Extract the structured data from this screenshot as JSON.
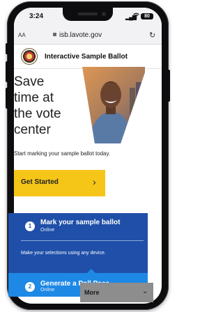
{
  "status_bar": {
    "time": "3:24",
    "battery": "80",
    "icons": [
      "signal-icon",
      "wifi-icon",
      "battery-icon"
    ]
  },
  "browser": {
    "text_size_label": "AA",
    "url": "isb.lavote.gov",
    "icons": [
      "lock-icon",
      "reload-icon"
    ]
  },
  "header": {
    "title": "Interactive Sample Ballot",
    "logo": "county-seal-logo"
  },
  "hero": {
    "lines": [
      "Save",
      "time at",
      "the vote",
      "center"
    ],
    "subtitle": "Start marking your sample ballot today."
  },
  "cta": {
    "label": "Get Started",
    "icon": "chevron-right-icon"
  },
  "steps": [
    {
      "number": "1",
      "title": "Mark your sample ballot",
      "subtitle": "Online",
      "description": "Make your selections using any device."
    },
    {
      "number": "2",
      "title": "Generate a Poll Pass",
      "subtitle": "Online"
    }
  ],
  "more_menu": {
    "label": "More",
    "icon": "chevron-down-icon"
  },
  "colors": {
    "accent_yellow": "#f5c518",
    "card_blue": "#1f4fa8",
    "step2_blue": "#1e88e5"
  }
}
